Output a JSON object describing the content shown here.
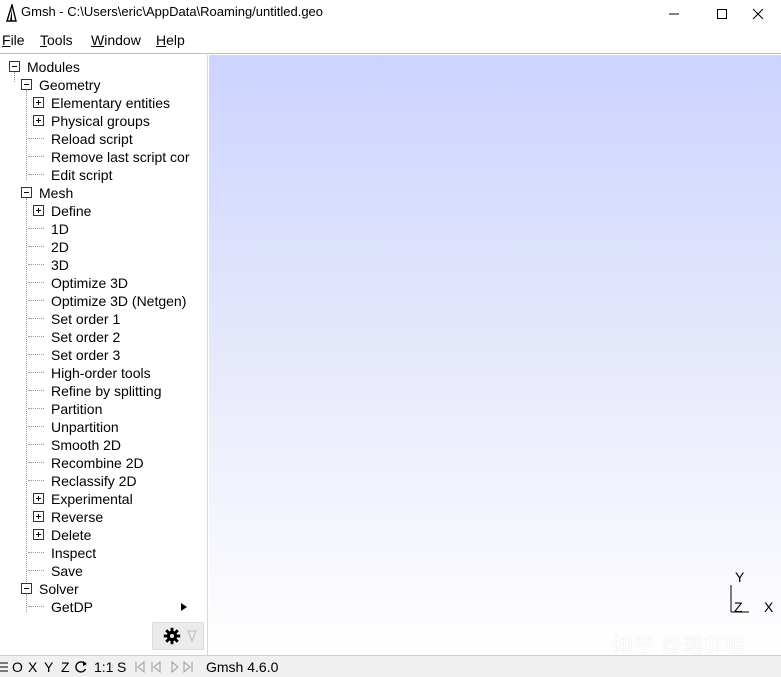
{
  "window": {
    "title": "Gmsh - C:\\Users\\eric\\AppData\\Roaming/untitled.geo",
    "icons": [
      "app-icon",
      "minimize-icon",
      "maximize-icon",
      "close-icon"
    ]
  },
  "menu": {
    "items": [
      {
        "mnemonic": "F",
        "rest": "ile"
      },
      {
        "mnemonic": "T",
        "rest": "ools"
      },
      {
        "mnemonic": "W",
        "rest": "indow"
      },
      {
        "mnemonic": "H",
        "rest": "elp"
      }
    ]
  },
  "tree": {
    "modules": "Modules",
    "geometry": {
      "label": "Geometry",
      "items": [
        "Elementary entities",
        "Physical groups",
        "Reload script",
        "Remove last script cor",
        "Edit script"
      ]
    },
    "mesh": {
      "label": "Mesh",
      "items": [
        "Define",
        "1D",
        "2D",
        "3D",
        "Optimize 3D",
        "Optimize 3D (Netgen)",
        "Set order 1",
        "Set order 2",
        "Set order 3",
        "High-order tools",
        "Refine by splitting",
        "Partition",
        "Unpartition",
        "Smooth 2D",
        "Recombine 2D",
        "Reclassify 2D",
        "Experimental",
        "Reverse",
        "Delete",
        "Inspect",
        "Save"
      ]
    },
    "solver": {
      "label": "Solver",
      "items": [
        "GetDP"
      ]
    },
    "expanders": {
      "collapse_glyph": "minus-box-icon",
      "expand_glyph": "plus-box-icon",
      "submenu_glyph": "arrow-right-icon"
    }
  },
  "graphic": {
    "axes": {
      "y": "Y",
      "z": "Z",
      "x": "X"
    },
    "watermark": "知乎 @迦非喵",
    "gradient_top": "#ccd3ff",
    "gradient_bottom": "#ffffff"
  },
  "statusbar": {
    "items": [
      "O",
      "X",
      "Y",
      "Z"
    ],
    "scale": "1:1",
    "s": "S",
    "nav_glyphs": [
      "first-icon",
      "prev-icon",
      "play-icon",
      "next-icon"
    ],
    "version": "Gmsh 4.6.0"
  }
}
